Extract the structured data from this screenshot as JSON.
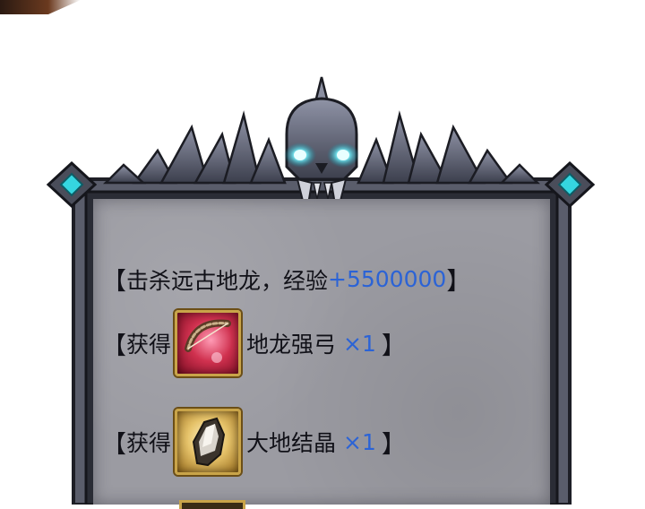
{
  "messages": {
    "line1": {
      "open": "【",
      "text": "击杀远古地龙，经验",
      "exp": "+5500000",
      "close": "】"
    },
    "items": [
      {
        "open": "【",
        "prefix": "获得",
        "name": "地龙强弓",
        "qty": "×1",
        "close": "】",
        "icon": "bow-icon",
        "rarity_color": "#d0314f"
      },
      {
        "open": "【",
        "prefix": "获得",
        "name": "大地结晶",
        "qty": "×1",
        "close": "】",
        "icon": "crystal-icon",
        "rarity_color": "#e6c36a"
      }
    ]
  },
  "colors": {
    "accent": "#2b63d6",
    "gem": "#35d6e0"
  }
}
